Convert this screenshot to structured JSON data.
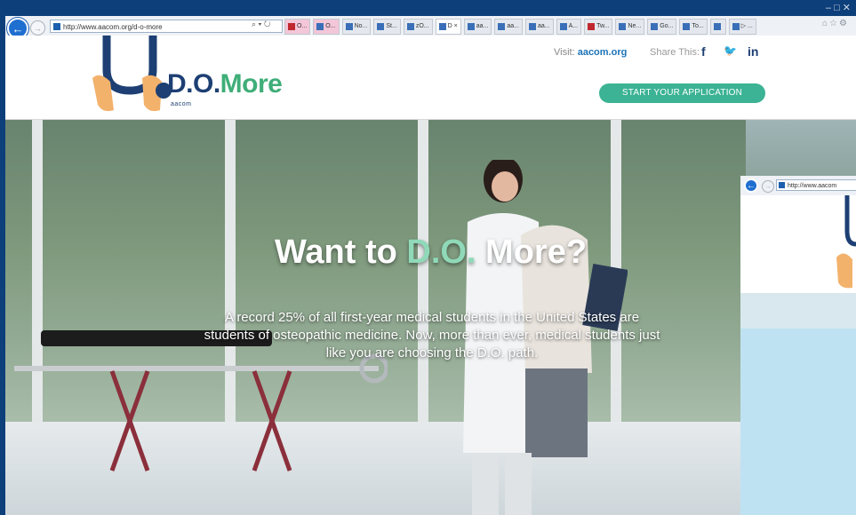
{
  "browser": {
    "url": "http://www.aacom.org/d-o-more",
    "address_tools": "⌕ ▾ ↻",
    "tabs": [
      {
        "label": "O...",
        "style": "pink red"
      },
      {
        "label": "O...",
        "style": "pink"
      },
      {
        "label": "No...",
        "style": ""
      },
      {
        "label": "St...",
        "style": ""
      },
      {
        "label": "zO...",
        "style": ""
      },
      {
        "label": "D ×",
        "style": "active"
      },
      {
        "label": "aa...",
        "style": ""
      },
      {
        "label": "aa...",
        "style": ""
      },
      {
        "label": "aa...",
        "style": ""
      },
      {
        "label": "A...",
        "style": ""
      },
      {
        "label": "Tw...",
        "style": "red"
      },
      {
        "label": "Ne...",
        "style": ""
      },
      {
        "label": "Go...",
        "style": ""
      },
      {
        "label": "To...",
        "style": ""
      },
      {
        "label": "",
        "style": ""
      },
      {
        "label": "▷ ...",
        "style": ""
      }
    ],
    "window_controls": "–   □   ✕",
    "right_tools": "⌂☆⚙"
  },
  "header": {
    "logo_do": "D.O.",
    "logo_more": "More",
    "logo_sub": "aacom",
    "visit_label": "Visit:",
    "visit_link": "aacom.org",
    "share_label": "Share This:",
    "social": {
      "facebook": "f",
      "twitter": "🐦",
      "linkedin": "in"
    },
    "apply_button": "START YOUR APPLICATION"
  },
  "hero": {
    "title_pre": "Want to ",
    "title_accent": "D.O.",
    "title_post": " More?",
    "body": "A record 25% of all first-year medical students in the United States are students of osteopathic medicine. Now, more than ever, medical students just like you are choosing the D.O. path."
  },
  "second_window": {
    "url": "http://www.aacom"
  },
  "colors": {
    "accent_green": "#3fae78",
    "button_teal": "#3bb394",
    "navy": "#1d3f73",
    "browser_blue": "#1f6fd1"
  }
}
